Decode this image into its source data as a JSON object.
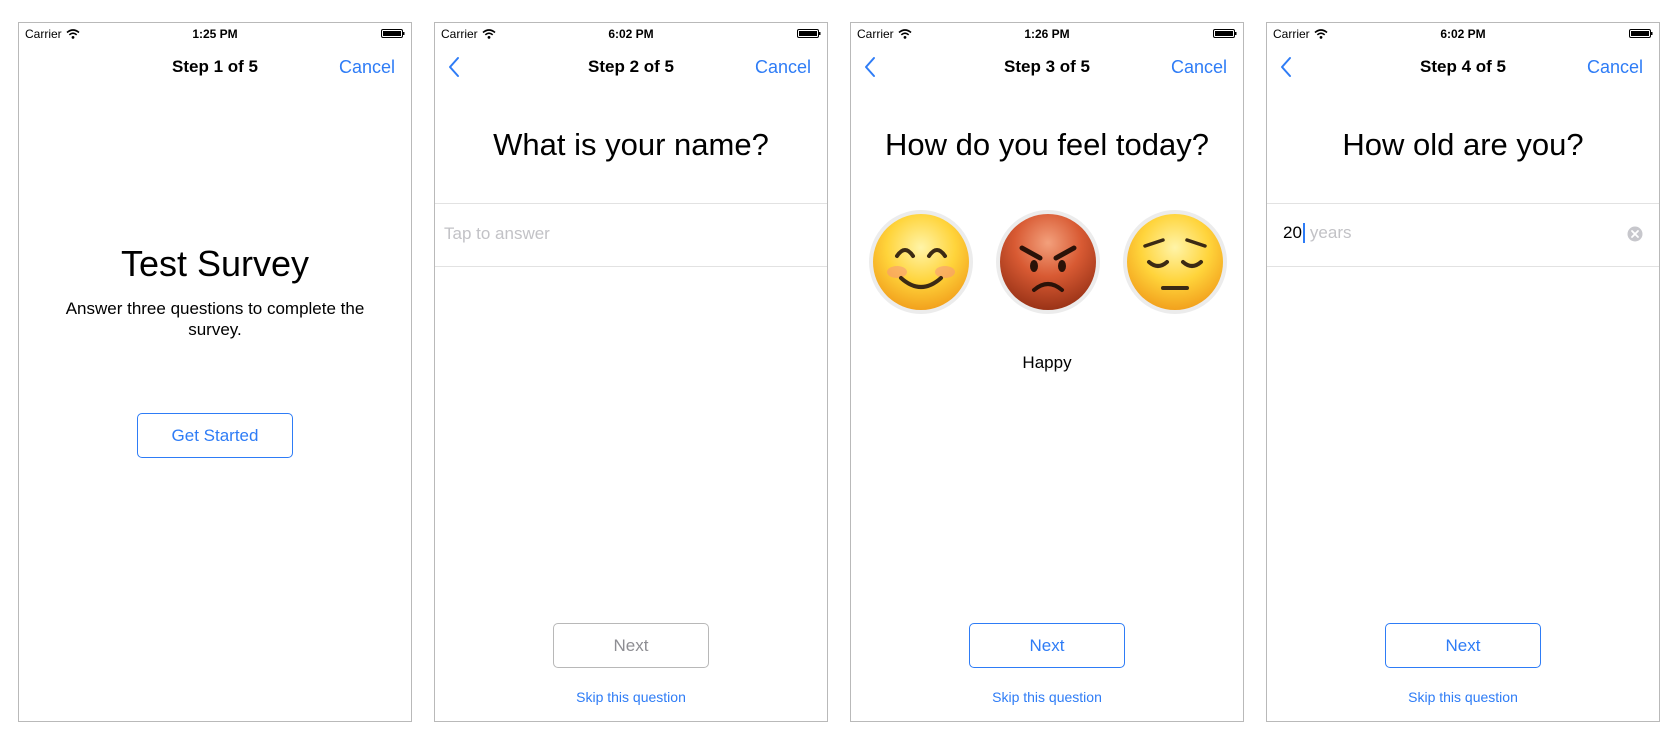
{
  "screens": [
    {
      "status": {
        "carrier": "Carrier",
        "time": "1:25 PM"
      },
      "nav": {
        "title": "Step 1 of 5",
        "cancel": "Cancel"
      },
      "intro": {
        "title": "Test Survey",
        "text": "Answer three questions to complete the survey."
      },
      "start_button": "Get Started"
    },
    {
      "status": {
        "carrier": "Carrier",
        "time": "6:02 PM"
      },
      "nav": {
        "title": "Step 2 of 5",
        "cancel": "Cancel"
      },
      "question": "What is your name?",
      "answer_placeholder": "Tap to answer",
      "next_button": "Next",
      "next_enabled": false,
      "skip": "Skip this question"
    },
    {
      "status": {
        "carrier": "Carrier",
        "time": "1:26 PM"
      },
      "nav": {
        "title": "Step 3 of 5",
        "cancel": "Cancel"
      },
      "question": "How do you feel today?",
      "moods": [
        "happy-face-icon",
        "angry-face-icon",
        "sad-face-icon"
      ],
      "selected_mood": "Happy",
      "next_button": "Next",
      "skip": "Skip this question"
    },
    {
      "status": {
        "carrier": "Carrier",
        "time": "6:02 PM"
      },
      "nav": {
        "title": "Step 4 of 5",
        "cancel": "Cancel"
      },
      "question": "How old are you?",
      "age_value": "20",
      "age_unit": "years",
      "next_button": "Next",
      "skip": "Skip this question"
    }
  ],
  "colors": {
    "accent": "#2e7cf6",
    "placeholder": "#c2c2c6",
    "disabled": "#8e8e93"
  }
}
